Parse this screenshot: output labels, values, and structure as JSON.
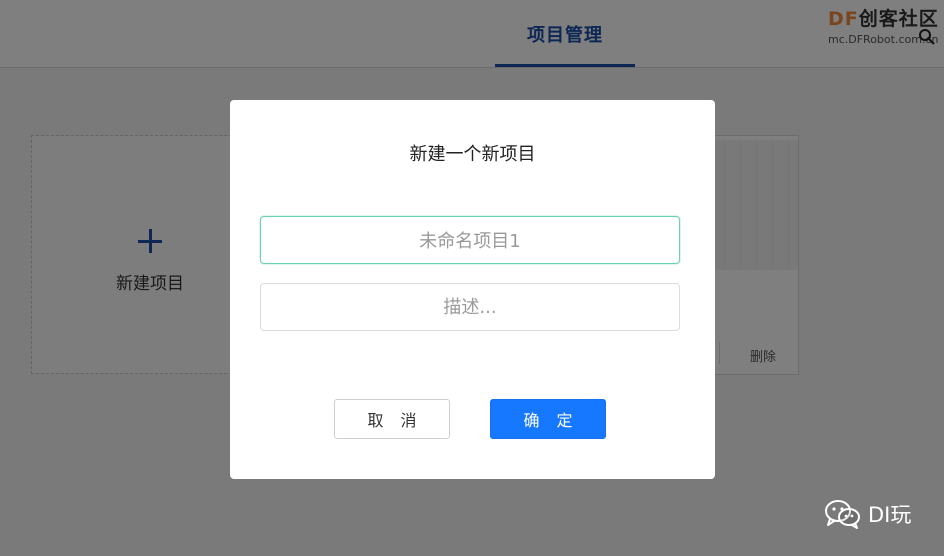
{
  "header": {
    "active_tab": "项目管理",
    "brand": {
      "logo_prefix": "DF",
      "logo_text": "创客社区",
      "url": "mc.DFRobot.com.cn"
    }
  },
  "background": {
    "new_project_label": "新建项目",
    "project_card": {
      "delete_label": "删除"
    }
  },
  "dialog": {
    "title": "新建一个新项目",
    "name_input": {
      "value": "未命名项目1",
      "placeholder": ""
    },
    "description_input": {
      "value": "",
      "placeholder": "描述..."
    },
    "cancel_label": "取 消",
    "confirm_label": "确 定"
  },
  "watermark": {
    "text": "DI玩",
    "icon": "wechat-icon"
  },
  "colors": {
    "accent": "#1a4ea8",
    "primary_button": "#1677ff",
    "focus_border": "#6cd3b0"
  }
}
